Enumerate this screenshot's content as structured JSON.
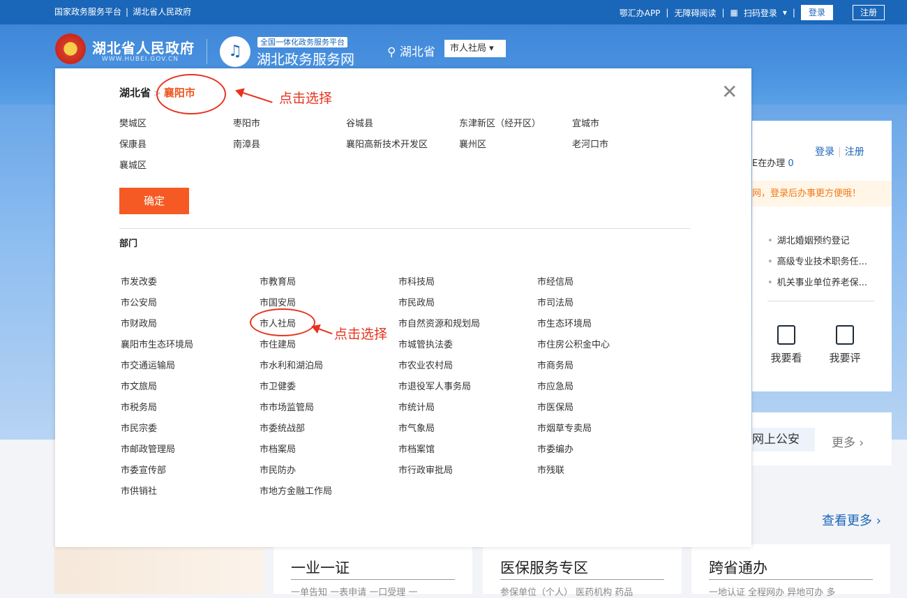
{
  "topbar": {
    "left_links": [
      "国家政务服务平台",
      "湖北省人民政府"
    ],
    "app_link": "鄂汇办APP",
    "accessible_link": "无障碍阅读",
    "qr_login": "扫码登录",
    "login_btn": "登录",
    "register_btn": "注册"
  },
  "header": {
    "gov_name": "湖北省人民政府",
    "gov_url": "WWW.HUBEI.GOV.CN",
    "platform_tag": "全国一体化政务服务平台",
    "platform_name": "湖北政务服务网",
    "location": "湖北省",
    "dept_selected": "市人社局"
  },
  "background": {
    "login": "登录",
    "register": "注册",
    "in_progress_label": "E在办理",
    "in_progress_count": "0",
    "tip": "网，登录后办事更方便哦！",
    "hot_items": [
      "湖北婚姻预约登记",
      "高级专业技术职务任...",
      "机关事业单位养老保..."
    ],
    "action_view": "我要看",
    "action_rate": "我要评",
    "police_online": "网上公安",
    "more": "更多",
    "see_more": "查看更多",
    "cards": [
      {
        "title": "一业一证",
        "sub": "一单告知   一表申请   一口受理   一"
      },
      {
        "title": "医保服务专区",
        "sub": "参保单位（个人）   医药机构   药品"
      },
      {
        "title": "跨省通办",
        "sub": "一地认证   全程网办   异地可办   多"
      }
    ]
  },
  "modal": {
    "province": "湖北省",
    "city": "襄阳市",
    "annotation": "点击选择",
    "districts": [
      [
        "樊城区",
        "枣阳市",
        "谷城县",
        "东津新区（经开区）",
        "宜城市"
      ],
      [
        "保康县",
        "南漳县",
        "襄阳高新技术开发区",
        "襄州区",
        "老河口市"
      ],
      [
        "襄城区"
      ]
    ],
    "confirm": "确定",
    "dept_heading": "部门",
    "departments": [
      [
        "市发改委",
        "市教育局",
        "市科技局",
        "市经信局"
      ],
      [
        "市公安局",
        "市国安局",
        "市民政局",
        "市司法局"
      ],
      [
        "市财政局",
        "市人社局",
        "市自然资源和规划局",
        "市生态环境局"
      ],
      [
        "襄阳市生态环境局",
        "市住建局",
        "市城管执法委",
        "市住房公积金中心"
      ],
      [
        "市交通运输局",
        "市水利和湖泊局",
        "市农业农村局",
        "市商务局"
      ],
      [
        "市文旅局",
        "市卫健委",
        "市退役军人事务局",
        "市应急局"
      ],
      [
        "市税务局",
        "市市场监管局",
        "市统计局",
        "市医保局"
      ],
      [
        "市民宗委",
        "市委统战部",
        "市气象局",
        "市烟草专卖局"
      ],
      [
        "市邮政管理局",
        "市档案局",
        "市档案馆",
        "市委编办"
      ],
      [
        "市委宣传部",
        "市民防办",
        "市行政审批局",
        "市残联"
      ],
      [
        "市供销社",
        "市地方金融工作局"
      ]
    ]
  }
}
